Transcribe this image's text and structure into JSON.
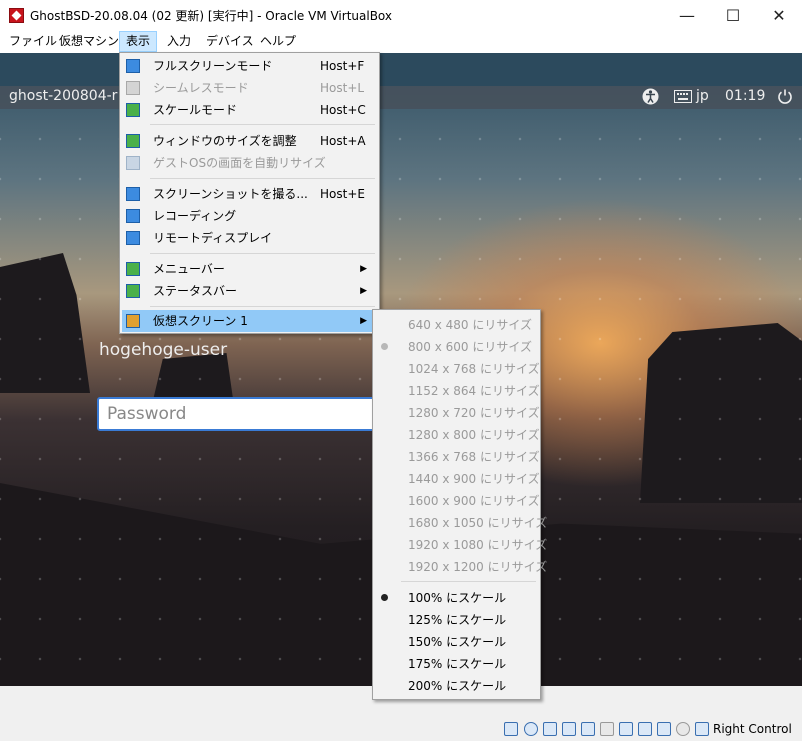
{
  "window": {
    "title": "GhostBSD-20.08.04 (02 更新) [実行中] - Oracle VM VirtualBox",
    "minimize": "—",
    "maximize": "☐",
    "close": "✕"
  },
  "menubar": {
    "items": [
      {
        "label": "ファイル"
      },
      {
        "label": "仮想マシン"
      },
      {
        "label": "表示",
        "active": true
      },
      {
        "label": "入力"
      },
      {
        "label": "デバイス"
      },
      {
        "label": "ヘルプ"
      }
    ]
  },
  "guest": {
    "hostname": "ghost-200804-r",
    "keyboard": "jp",
    "clock": "01:19",
    "user_label": "hogehoge-user",
    "password_placeholder": "Password"
  },
  "view_menu": {
    "items": [
      {
        "label": "フルスクリーンモード",
        "shortcut": "Host+F",
        "icon": "fullscreen-icon",
        "disabled": false
      },
      {
        "label": "シームレスモード",
        "shortcut": "Host+L",
        "icon": "seamless-icon",
        "disabled": true
      },
      {
        "label": "スケールモード",
        "shortcut": "Host+C",
        "icon": "scale-icon",
        "disabled": false
      },
      {
        "label": "ウィンドウのサイズを調整",
        "shortcut": "Host+A",
        "icon": "adjust-window-icon",
        "disabled": false
      },
      {
        "label": "ゲストOSの画面を自動リサイズ",
        "shortcut": "",
        "icon": "auto-resize-icon",
        "disabled": true
      },
      {
        "label": "スクリーンショットを撮る...",
        "shortcut": "Host+E",
        "icon": "screenshot-icon",
        "disabled": false
      },
      {
        "label": "レコーディング",
        "shortcut": "",
        "icon": "recording-icon",
        "disabled": false
      },
      {
        "label": "リモートディスプレイ",
        "shortcut": "",
        "icon": "remote-display-icon",
        "disabled": false
      },
      {
        "label": "メニューバー",
        "shortcut": "",
        "icon": "menubar-icon",
        "submenu": true
      },
      {
        "label": "ステータスバー",
        "shortcut": "",
        "icon": "statusbar-icon",
        "submenu": true
      },
      {
        "label": "仮想スクリーン 1",
        "shortcut": "",
        "icon": "virtual-screen-icon",
        "submenu": true,
        "highlighted": true
      }
    ]
  },
  "screen_submenu": {
    "resize_items": [
      {
        "label": "640 x 480 にリサイズ",
        "selected": false
      },
      {
        "label": "800 x 600 にリサイズ",
        "selected": true
      },
      {
        "label": "1024 x 768 にリサイズ",
        "selected": false
      },
      {
        "label": "1152 x 864 にリサイズ",
        "selected": false
      },
      {
        "label": "1280 x 720 にリサイズ",
        "selected": false
      },
      {
        "label": "1280 x 800 にリサイズ",
        "selected": false
      },
      {
        "label": "1366 x 768 にリサイズ",
        "selected": false
      },
      {
        "label": "1440 x 900 にリサイズ",
        "selected": false
      },
      {
        "label": "1600 x 900 にリサイズ",
        "selected": false
      },
      {
        "label": "1680 x 1050 にリサイズ",
        "selected": false
      },
      {
        "label": "1920 x 1080 にリサイズ",
        "selected": false
      },
      {
        "label": "1920 x 1200 にリサイズ",
        "selected": false
      }
    ],
    "scale_items": [
      {
        "label": "100% にスケール",
        "selected": true
      },
      {
        "label": "125% にスケール",
        "selected": false
      },
      {
        "label": "150% にスケール",
        "selected": false
      },
      {
        "label": "175% にスケール",
        "selected": false
      },
      {
        "label": "200% にスケール",
        "selected": false
      }
    ]
  },
  "statusbar": {
    "host_key_label": "Right Control",
    "icons": [
      "hard-disk-icon",
      "optical-drive-icon",
      "audio-icon",
      "network-icon",
      "usb-icon",
      "shared-folders-icon",
      "display-icon",
      "recording-icon",
      "cpu-icon",
      "mouse-integration-icon",
      "keyboard-capture-icon",
      "host-key-arrow-icon"
    ]
  },
  "colors": {
    "menu_highlight": "#91c9f7",
    "menubar_active": "#cce8ff",
    "icon_blue": "#3c8be0"
  }
}
